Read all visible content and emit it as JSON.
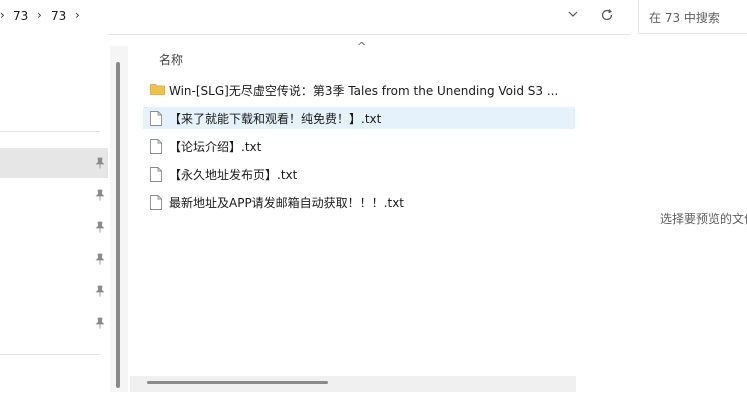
{
  "address_bar": {
    "crumbs": [
      "73",
      "73"
    ],
    "separator": "›",
    "dropdown_icon": "chevron-down-icon",
    "refresh_icon": "refresh-icon"
  },
  "search": {
    "placeholder": "在 73 中搜索"
  },
  "file_list": {
    "column_name": "名称",
    "sort_indicator": "^",
    "items": [
      {
        "label": "Win-[SLG]无尽虚空传说：第3季  Tales from the Unending Void  S3  ...",
        "type": "folder"
      },
      {
        "label": "【来了就能下载和观看！纯免费！】.txt",
        "type": "txt",
        "selected": true
      },
      {
        "label": "【论坛介绍】.txt",
        "type": "txt"
      },
      {
        "label": "【永久地址发布页】.txt",
        "type": "txt"
      },
      {
        "label": "最新地址及APP请发邮箱自动获取！！！.txt",
        "type": "txt"
      }
    ]
  },
  "preview": {
    "message": "选择要预览的文件"
  },
  "colors": {
    "selected_row": "#e5f1fb",
    "folder": "#f0c24b",
    "nav_selected": "#e6e6e6"
  }
}
